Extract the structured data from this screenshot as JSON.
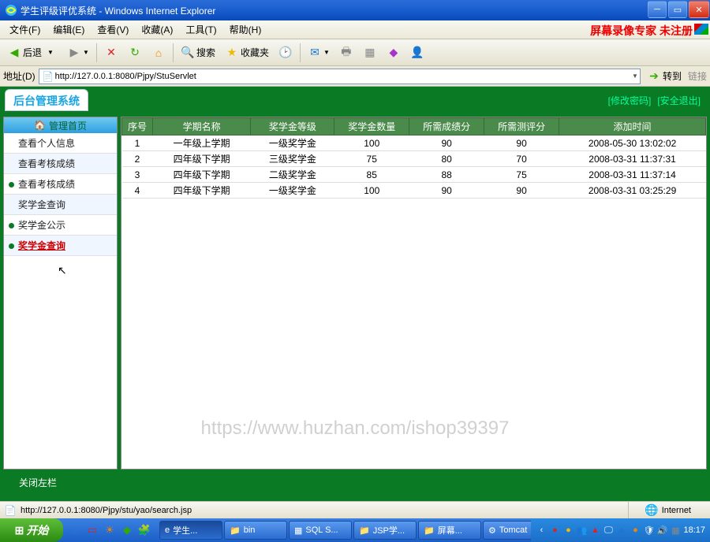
{
  "window": {
    "title": "学生评级评优系统 - Windows Internet Explorer"
  },
  "unregistered": "屏幕录像专家 未注册",
  "menus": [
    "文件(F)",
    "编辑(E)",
    "查看(V)",
    "收藏(A)",
    "工具(T)",
    "帮助(H)"
  ],
  "toolbar": {
    "back": "后退",
    "search": "搜索",
    "favorites": "收藏夹"
  },
  "address": {
    "label": "地址(D)",
    "url": "http://127.0.0.1:8080/Pjpy/StuServlet",
    "go": "转到",
    "links": "链接"
  },
  "banner": {
    "title": "后台管理系统",
    "link_pwd": "[修改密码]",
    "link_exit": "[安全退出]"
  },
  "sidebar": {
    "head": "管理首页",
    "items": [
      {
        "label": "查看个人信息",
        "bullet": false
      },
      {
        "label": "查看考核成绩",
        "bullet": false
      },
      {
        "label": "查看考核成绩",
        "bullet": true
      },
      {
        "label": "奖学金查询",
        "bullet": false
      },
      {
        "label": "奖学金公示",
        "bullet": true
      },
      {
        "label": "奖学金查询",
        "bullet": true,
        "active": true
      }
    ]
  },
  "table": {
    "headers": [
      "序号",
      "学期名称",
      "奖学金等级",
      "奖学金数量",
      "所需成绩分",
      "所需测评分",
      "添加时间"
    ],
    "rows": [
      [
        "1",
        "一年级上学期",
        "一级奖学金",
        "100",
        "90",
        "90",
        "2008-05-30 13:02:02"
      ],
      [
        "2",
        "四年级下学期",
        "三级奖学金",
        "75",
        "80",
        "70",
        "2008-03-31 11:37:31"
      ],
      [
        "3",
        "四年级下学期",
        "二级奖学金",
        "85",
        "88",
        "75",
        "2008-03-31 11:37:14"
      ],
      [
        "4",
        "四年级下学期",
        "一级奖学金",
        "100",
        "90",
        "90",
        "2008-03-31 03:25:29"
      ]
    ]
  },
  "watermark": "https://www.huzhan.com/ishop39397",
  "footer": "关闭左栏",
  "status": {
    "text": "http://127.0.0.1:8080/Pjpy/stu/yao/search.jsp",
    "zone": "Internet"
  },
  "taskbar": {
    "start": "开始",
    "tasks": [
      {
        "label": "学生..."
      },
      {
        "label": "bin"
      },
      {
        "label": "SQL S..."
      },
      {
        "label": "JSP学..."
      },
      {
        "label": "屏幕..."
      },
      {
        "label": "Tomcat"
      }
    ],
    "clock": "18:17"
  }
}
